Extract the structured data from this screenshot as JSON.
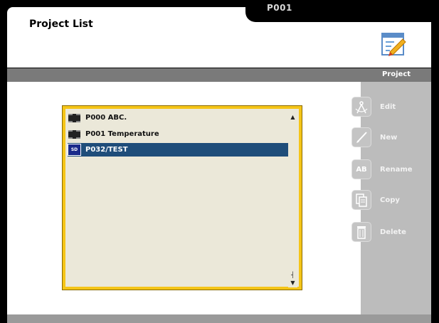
{
  "header": {
    "title": "Project List",
    "tab_label": "P001",
    "edit_icon": "notepad-pencil-icon"
  },
  "strip": {
    "label": "Project"
  },
  "project_list": {
    "items": [
      {
        "label": "P000 ABC.",
        "icon": "chip-icon",
        "selected": false
      },
      {
        "label": "P001 Temperature",
        "icon": "chip-icon",
        "selected": false
      },
      {
        "label": "P032/TEST",
        "icon": "sd-card-icon",
        "icon_text": "SD",
        "selected": true
      }
    ]
  },
  "side_menu": {
    "edit": {
      "label": "Edit",
      "icon": "compass-icon"
    },
    "new": {
      "label": "New",
      "icon": "pen-icon"
    },
    "rename": {
      "label": "Rename",
      "icon": "ab-rename-icon",
      "icon_text": "AB"
    },
    "copy": {
      "label": "Copy",
      "icon": "copy-documents-icon"
    },
    "delete": {
      "label": "Delete",
      "icon": "trash-icon"
    }
  },
  "colors": {
    "selection": "#1f4d7a",
    "list_border": "#f5c518",
    "side_panel": "#bcbcbc"
  }
}
